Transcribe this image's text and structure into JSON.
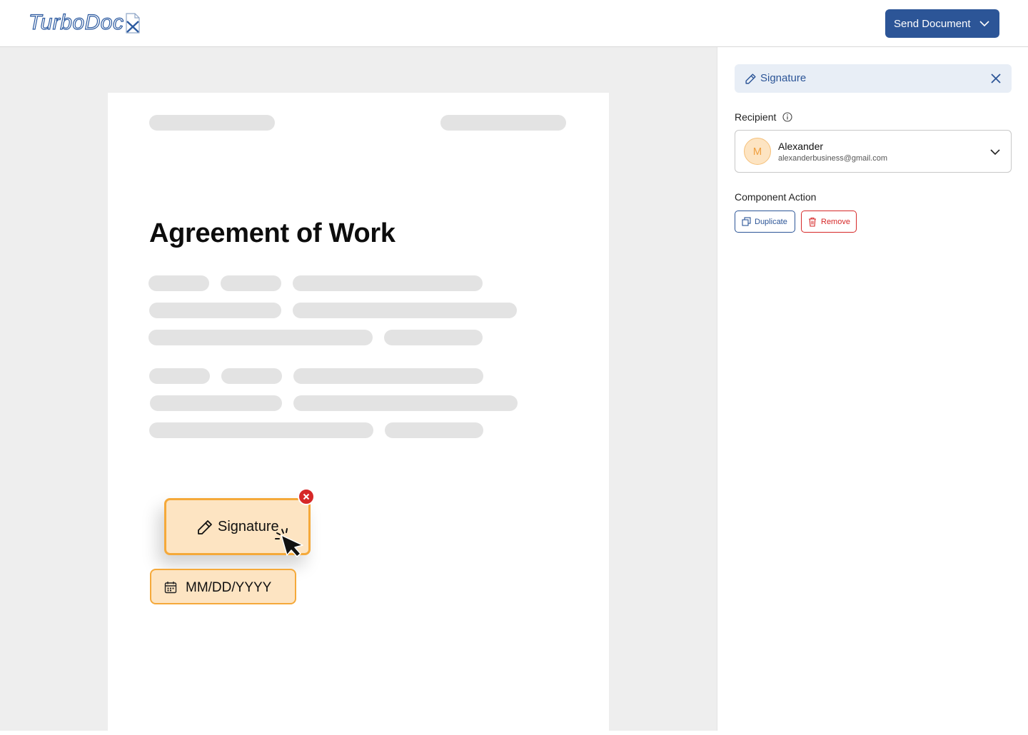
{
  "header": {
    "logo_text": "TurboDoc",
    "send_button_label": "Send Document",
    "colors": {
      "brand": "#2c5597"
    }
  },
  "document": {
    "title": "Agreement of Work",
    "signature_field": {
      "label": "Signature",
      "icon": "pencil-icon"
    },
    "date_field": {
      "label": "MM/DD/YYYY",
      "icon": "calendar-icon"
    },
    "field_color": "#fde4c2",
    "field_border_color": "#f5a93a"
  },
  "panel": {
    "header_label": "Signature",
    "recipient_label": "Recipient",
    "recipient": {
      "initial": "M",
      "name": "Alexander",
      "email": "alexanderbusiness@gmail.com"
    },
    "component_action_label": "Component Action",
    "duplicate_label": "Duplicate",
    "remove_label": "Remove",
    "colors": {
      "remove": "#d62828"
    }
  }
}
